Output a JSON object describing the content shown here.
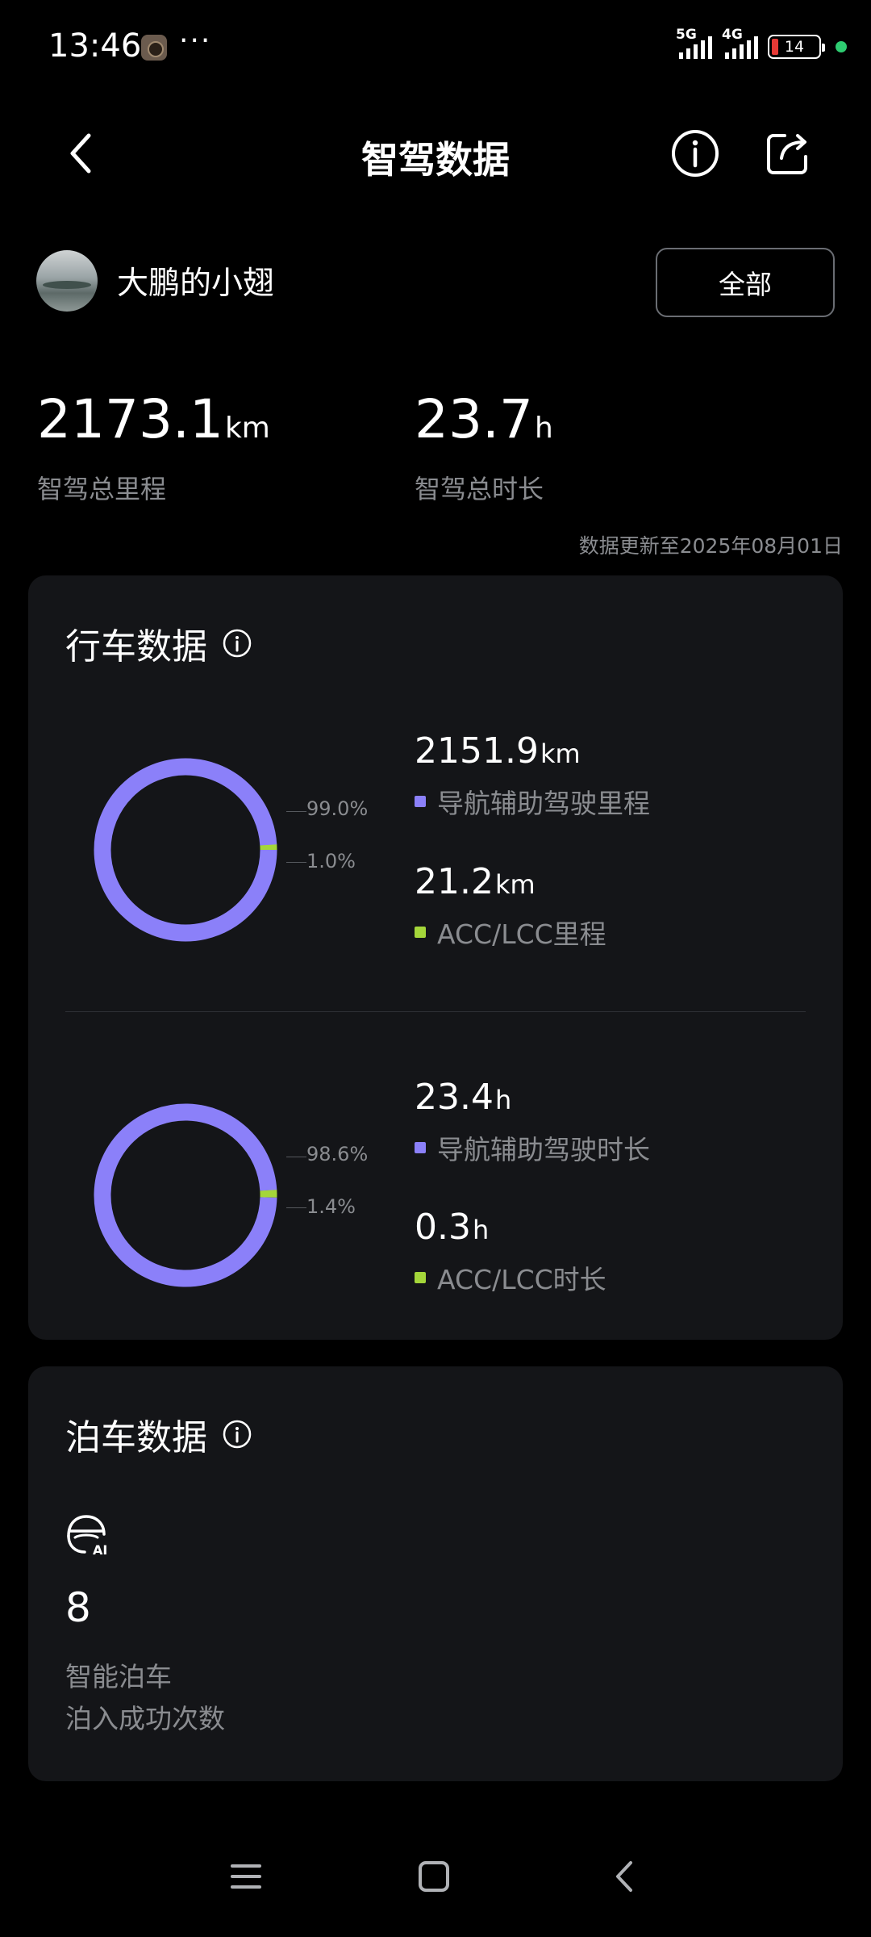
{
  "status_bar": {
    "time": "13:46",
    "dots": "···",
    "signal1_label": "5G",
    "signal2_label": "4G",
    "battery_percent": "14"
  },
  "header": {
    "title": "智驾数据",
    "back_icon": "chevron-left-icon",
    "info_icon": "info-circle-icon",
    "share_icon": "share-icon"
  },
  "profile": {
    "name": "大鹏的小翅",
    "filter_label": "全部"
  },
  "totals": {
    "mileage_value": "2173.1",
    "mileage_unit": "km",
    "mileage_label": "智驾总里程",
    "duration_value": "23.7",
    "duration_unit": "h",
    "duration_label": "智驾总时长",
    "updated_text": "数据更新至2025年08月01日"
  },
  "driving": {
    "title": "行车数据",
    "colors": {
      "nav": "#8b80f9",
      "acc": "#a4d63a"
    },
    "distance": {
      "nav_pct_label": "99.0%",
      "acc_pct_label": "1.0%",
      "nav_value": "2151.9",
      "nav_unit": "km",
      "nav_label": "导航辅助驾驶里程",
      "acc_value": "21.2",
      "acc_unit": "km",
      "acc_label": "ACC/LCC里程"
    },
    "time": {
      "nav_pct_label": "98.6%",
      "acc_pct_label": "1.4%",
      "nav_value": "23.4",
      "nav_unit": "h",
      "nav_label": "导航辅助驾驶时长",
      "acc_value": "0.3",
      "acc_unit": "h",
      "acc_label": "ACC/LCC时长"
    }
  },
  "chart_data": [
    {
      "type": "pie",
      "categories": [
        "导航辅助驾驶里程",
        "ACC/LCC里程"
      ],
      "values": [
        99.0,
        1.0
      ],
      "title": ""
    },
    {
      "type": "pie",
      "categories": [
        "导航辅助驾驶时长",
        "ACC/LCC时长"
      ],
      "values": [
        98.6,
        1.4
      ],
      "title": ""
    }
  ],
  "parking": {
    "title": "泊车数据",
    "icon": "ai-parking-icon",
    "count": "8",
    "label_line1": "智能泊车",
    "label_line2": "泊入成功次数"
  },
  "navbar": {
    "menu_icon": "menu-icon",
    "home_icon": "home-square-icon",
    "back_icon": "back-chevron-icon"
  }
}
